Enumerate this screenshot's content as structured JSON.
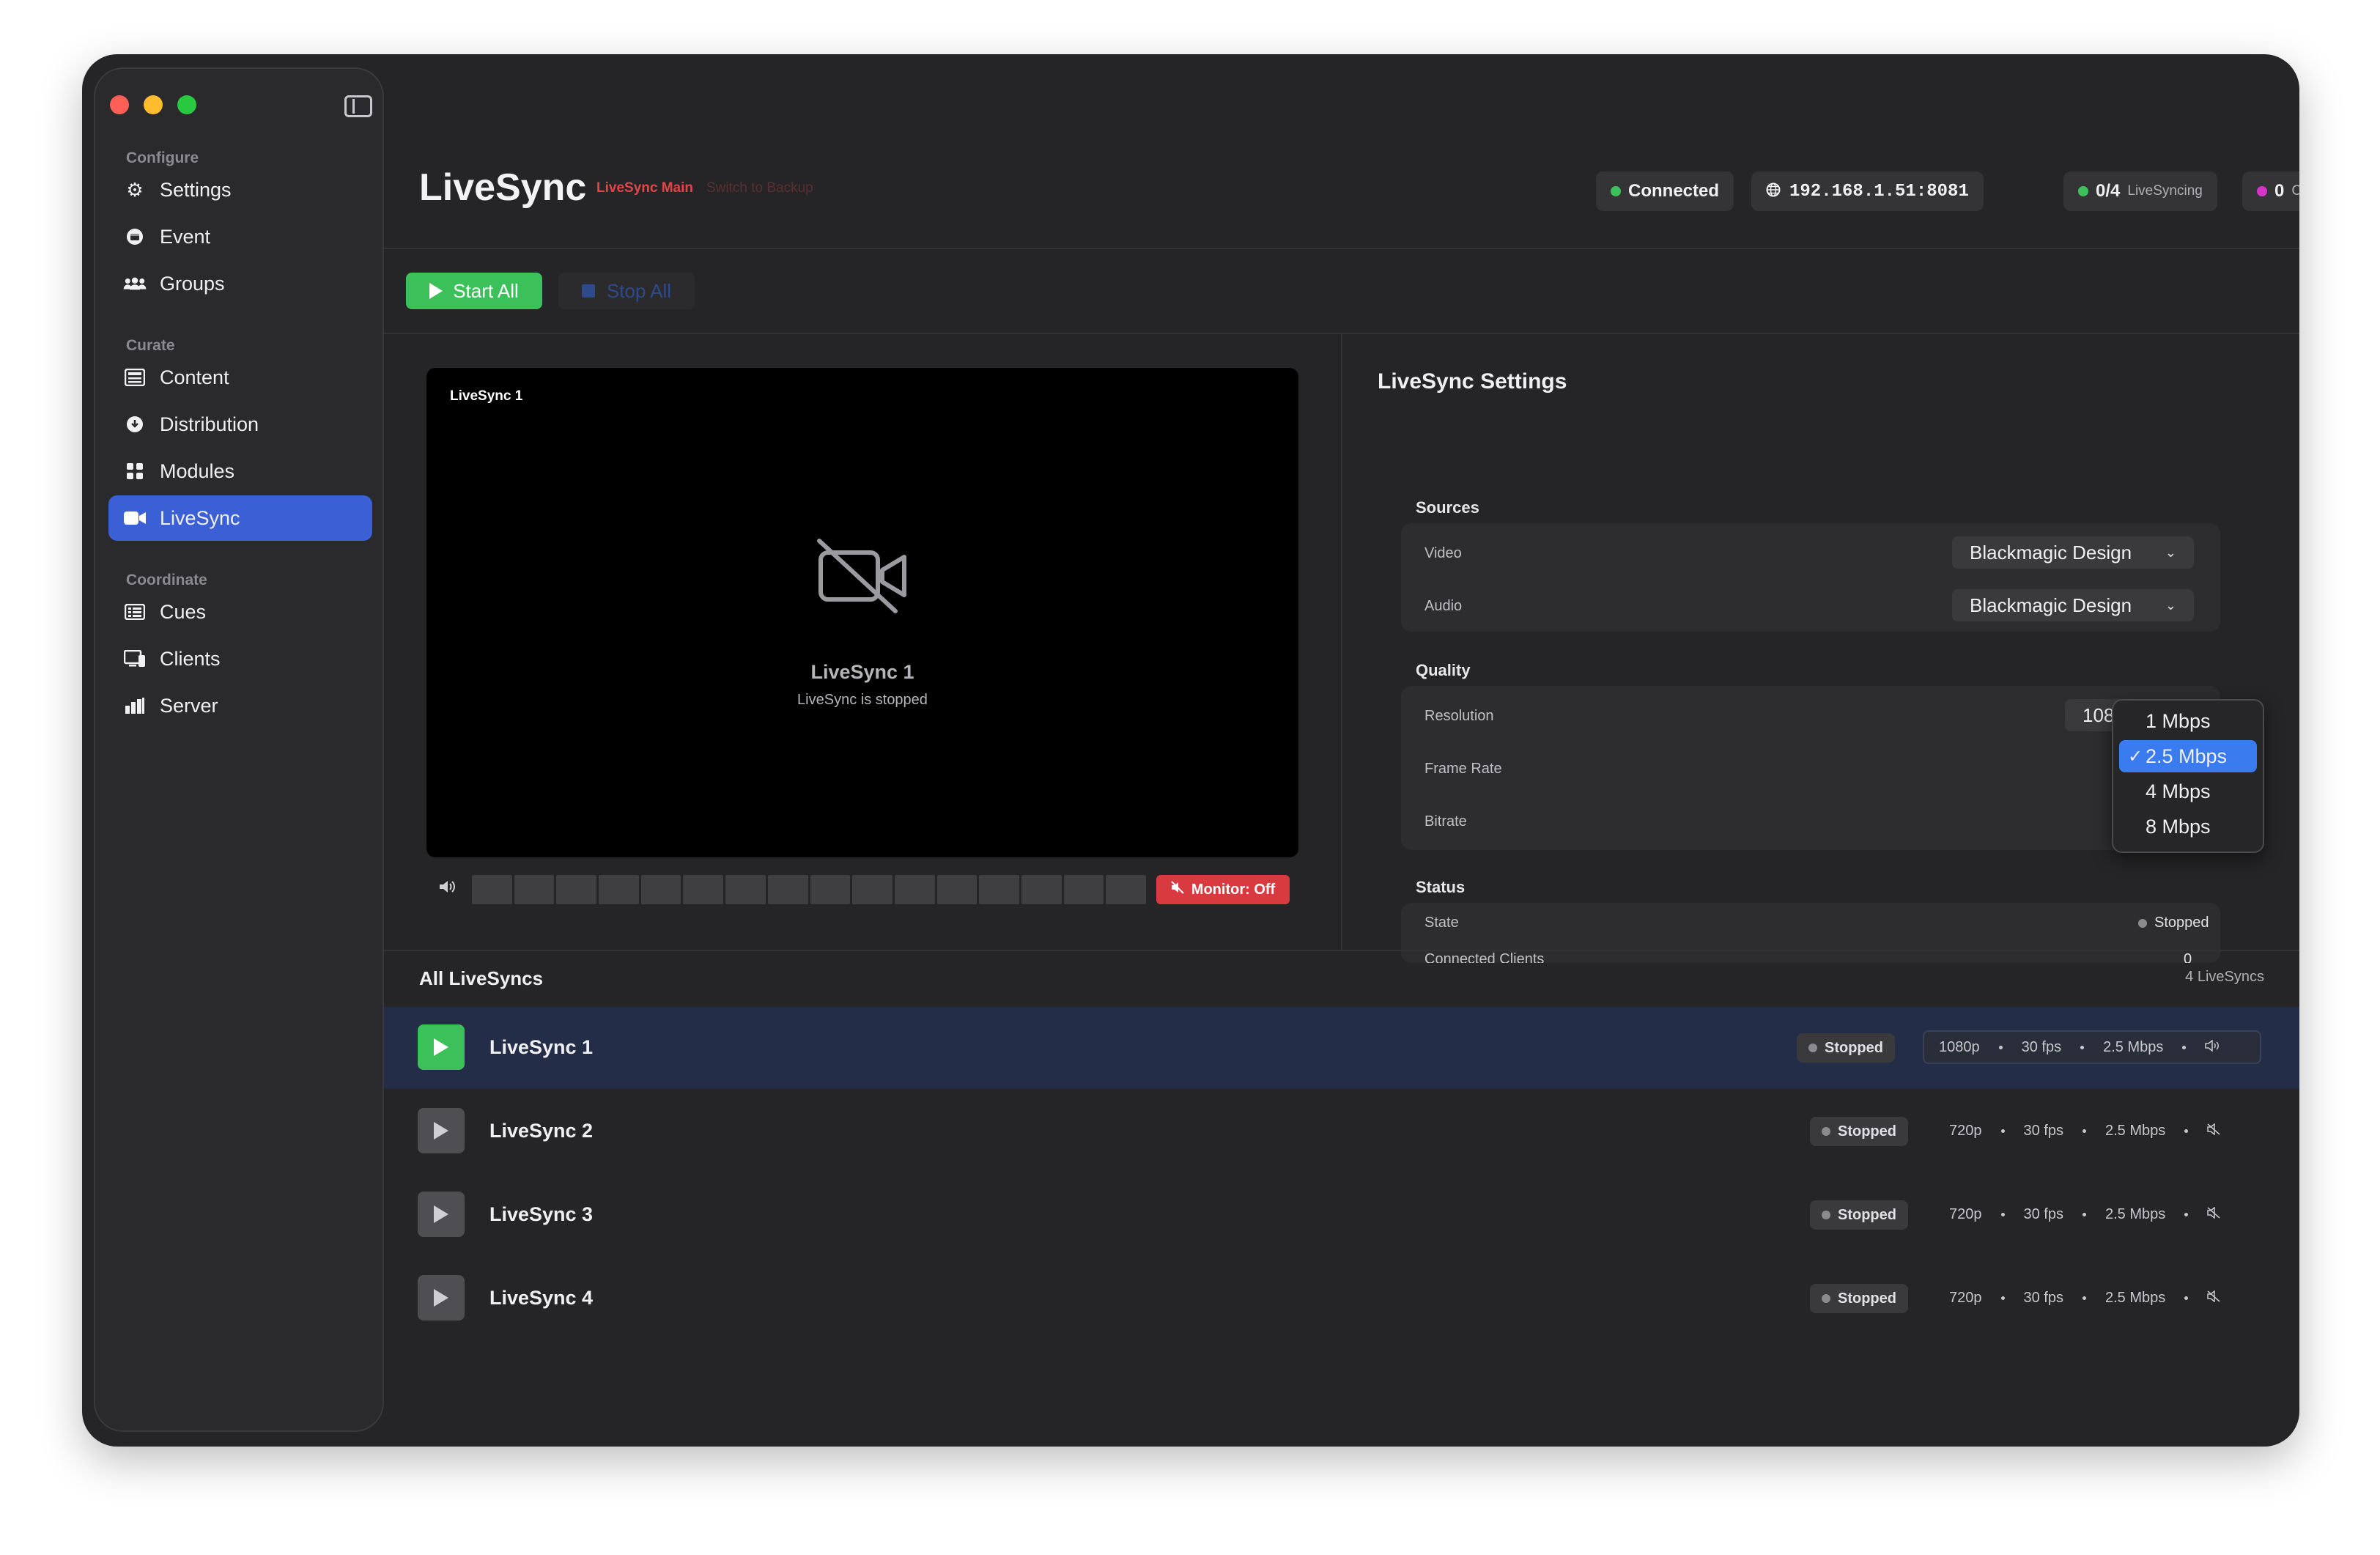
{
  "sidebar": {
    "sections": [
      {
        "label": "Configure",
        "items": [
          {
            "label": "Settings",
            "icon": "gear-icon"
          },
          {
            "label": "Event",
            "icon": "calendar-icon"
          },
          {
            "label": "Groups",
            "icon": "groups-icon"
          }
        ]
      },
      {
        "label": "Curate",
        "items": [
          {
            "label": "Content",
            "icon": "content-icon"
          },
          {
            "label": "Distribution",
            "icon": "download-icon"
          },
          {
            "label": "Modules",
            "icon": "grid-icon"
          },
          {
            "label": "LiveSync",
            "icon": "video-icon",
            "active": true
          }
        ]
      },
      {
        "label": "Coordinate",
        "items": [
          {
            "label": "Cues",
            "icon": "list-icon"
          },
          {
            "label": "Clients",
            "icon": "monitor-icon"
          },
          {
            "label": "Server",
            "icon": "bar-chart-icon"
          }
        ]
      }
    ]
  },
  "header": {
    "title": "LiveSync",
    "instance": "LiveSync Main",
    "switch_label": "Switch to Backup",
    "connection": "Connected",
    "address": "192.168.1.51:8081",
    "livesync_count": "0/4",
    "livesync_label": "LiveSyncing",
    "clients_count": "0",
    "clients_label": "Clients",
    "colors": {
      "connected": "#3cc15a",
      "clients": "#d633c8"
    }
  },
  "toolbar": {
    "start_all": "Start All",
    "stop_all": "Stop All"
  },
  "preview": {
    "label": "LiveSync 1",
    "name": "LiveSync 1",
    "status": "LiveSync is stopped",
    "monitor": "Monitor: Off",
    "level": 0
  },
  "settings": {
    "title": "LiveSync Settings",
    "sources": {
      "label": "Sources",
      "video_label": "Video",
      "video_value": "Blackmagic Design",
      "audio_label": "Audio",
      "audio_value": "Blackmagic Design"
    },
    "quality": {
      "label": "Quality",
      "resolution_label": "Resolution",
      "resolution_value": "1080p",
      "framerate_label": "Frame Rate",
      "bitrate_label": "Bitrate"
    },
    "status": {
      "label": "Status",
      "state_label": "State",
      "state_value": "Stopped",
      "clients_label": "Connected Clients",
      "clients_value": "0"
    },
    "bitrate_menu": {
      "options": [
        "1 Mbps",
        "2.5 Mbps",
        "4 Mbps",
        "8 Mbps"
      ],
      "selected": "2.5 Mbps",
      "check": "✓"
    }
  },
  "list": {
    "title": "All LiveSyncs",
    "count": "4 LiveSyncs",
    "rows": [
      {
        "name": "LiveSync 1",
        "status": "Stopped",
        "resolution": "1080p",
        "fps": "30 fps",
        "bitrate": "2.5 Mbps",
        "audio": "speaker-icon"
      },
      {
        "name": "LiveSync 2",
        "status": "Stopped",
        "resolution": "720p",
        "fps": "30 fps",
        "bitrate": "2.5 Mbps",
        "audio": "mute-icon"
      },
      {
        "name": "LiveSync 3",
        "status": "Stopped",
        "resolution": "720p",
        "fps": "30 fps",
        "bitrate": "2.5 Mbps",
        "audio": "mute-icon"
      },
      {
        "name": "LiveSync 4",
        "status": "Stopped",
        "resolution": "720p",
        "fps": "30 fps",
        "bitrate": "2.5 Mbps",
        "audio": "mute-icon"
      }
    ]
  }
}
